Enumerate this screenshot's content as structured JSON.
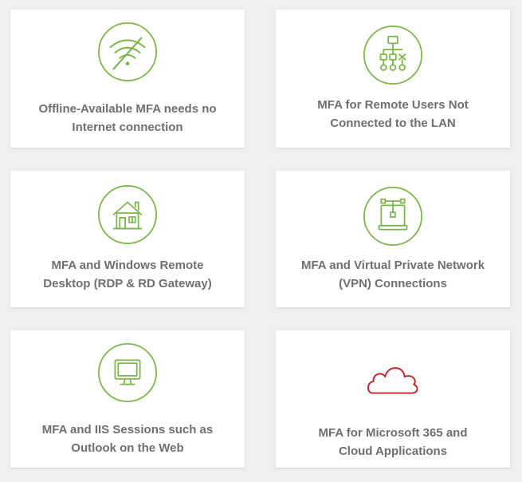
{
  "colors": {
    "accent": "#7ab648",
    "cloud": "#c0282d",
    "text": "#6f6f6f",
    "card_bg": "#ffffff",
    "page_bg": "#efefef"
  },
  "cards": [
    {
      "icon": "wifi-off-icon",
      "line1": "Offline-Available MFA needs no",
      "line2": "Internet connection"
    },
    {
      "icon": "network-hierarchy-icon",
      "line1": "MFA for Remote Users Not",
      "line2": "Connected to the LAN"
    },
    {
      "icon": "house-icon",
      "line1": "MFA and Windows Remote",
      "line2": "Desktop (RDP & RD Gateway)"
    },
    {
      "icon": "vpn-network-icon",
      "line1": "MFA and Virtual Private Network",
      "line2": "(VPN) Connections"
    },
    {
      "icon": "monitor-icon",
      "line1": "MFA and IIS Sessions such as",
      "line2": "Outlook on the Web"
    },
    {
      "icon": "cloud-icon",
      "line1": "MFA for Microsoft 365 and",
      "line2": "Cloud Applications"
    }
  ]
}
